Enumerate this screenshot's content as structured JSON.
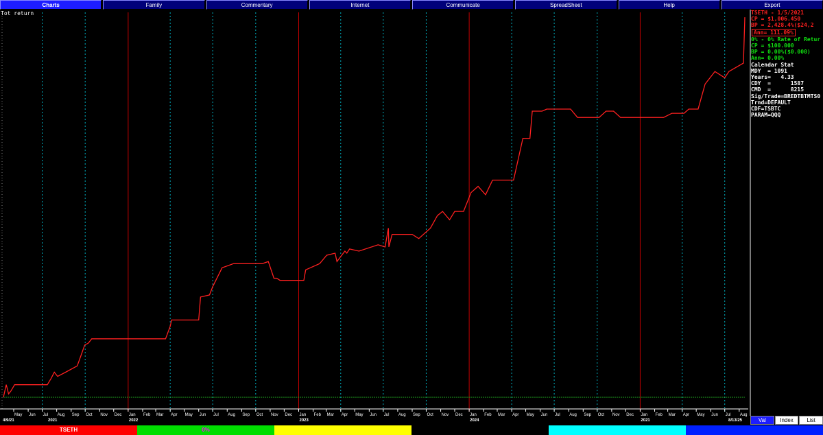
{
  "menu": {
    "items": [
      "Charts",
      "Family",
      "Commentary",
      "Internet",
      "Communicate",
      "SpreadSheet",
      "Help",
      "Export"
    ],
    "active_index": 0
  },
  "chart": {
    "title": "Tot return",
    "date_start": "4/9/21",
    "date_end": "8/13/25",
    "year_labels": [
      "2021",
      "2022",
      "2023",
      "2024"
    ],
    "month_labels": [
      "May",
      "Jun",
      "Jul",
      "Aug",
      "Sep",
      "Oct",
      "Nov",
      "Dec",
      "Jan",
      "Feb",
      "Mar",
      "Apr",
      "May",
      "Jun",
      "Jul",
      "Aug",
      "Sep",
      "Oct",
      "Nov",
      "Dec",
      "Jan",
      "Feb",
      "Mar",
      "Apr",
      "May",
      "Jun",
      "Jul",
      "Aug",
      "Sep",
      "Oct",
      "Nov",
      "Dec",
      "Jan",
      "Feb",
      "Mar",
      "Apr",
      "May",
      "Jun",
      "Jul",
      "Aug",
      "Sep",
      "Oct",
      "Nov",
      "Dec",
      "Jan",
      "Feb",
      "Mar",
      "Apr",
      "May",
      "Jun",
      "Jul",
      "Aug"
    ],
    "colors": {
      "line": "#ff2020",
      "grid": "#00b0c0",
      "year_line": "#c00000",
      "baseline": "#20a020"
    }
  },
  "chart_data": {
    "type": "line",
    "title": "Tot return",
    "xlabel": "",
    "ylabel": "",
    "x_range": [
      "2021-04-09",
      "2025-08-13"
    ],
    "ylim": [
      100,
      1020
    ],
    "series": [
      {
        "name": "TSETH",
        "color": "#ff2020",
        "x": [
          "2021-04-09",
          "2021-04-15",
          "2021-04-20",
          "2021-04-25",
          "2021-05-03",
          "2021-07-12",
          "2021-07-20",
          "2021-07-27",
          "2021-08-03",
          "2021-08-20",
          "2021-09-14",
          "2021-09-22",
          "2021-09-30",
          "2021-10-08",
          "2021-10-15",
          "2021-12-05",
          "2022-01-08",
          "2022-03-22",
          "2022-04-01",
          "2022-04-04",
          "2022-06-01",
          "2022-06-05",
          "2022-06-24",
          "2022-07-01",
          "2022-07-21",
          "2022-08-15",
          "2022-09-05",
          "2022-10-15",
          "2022-10-28",
          "2022-11-09",
          "2022-11-15",
          "2022-11-22",
          "2023-01-12",
          "2023-01-16",
          "2023-02-15",
          "2023-03-02",
          "2023-03-20",
          "2023-03-24",
          "2023-04-10",
          "2023-04-14",
          "2023-04-20",
          "2023-05-10",
          "2023-06-20",
          "2023-07-05",
          "2023-07-12",
          "2023-07-13",
          "2023-07-20",
          "2023-09-01",
          "2023-09-15",
          "2023-10-10",
          "2023-10-25",
          "2023-11-05",
          "2023-11-20",
          "2023-12-01",
          "2023-12-20",
          "2024-01-05",
          "2024-01-20",
          "2024-02-05",
          "2024-02-20",
          "2024-04-05",
          "2024-04-25",
          "2024-05-10",
          "2024-05-15",
          "2024-06-05",
          "2024-06-15",
          "2024-08-05",
          "2024-08-20",
          "2024-10-05",
          "2024-10-20",
          "2024-11-05",
          "2024-11-20",
          "2025-02-20",
          "2025-03-10",
          "2025-04-05",
          "2025-04-15",
          "2025-05-05",
          "2025-05-20",
          "2025-06-10",
          "2025-07-01",
          "2025-07-10",
          "2025-08-10",
          "2025-08-13"
        ],
        "y": [
          100,
          130,
          108,
          115,
          130,
          130,
          145,
          160,
          150,
          160,
          175,
          200,
          225,
          230,
          240,
          240,
          240,
          240,
          270,
          285,
          285,
          340,
          345,
          365,
          410,
          420,
          420,
          420,
          425,
          385,
          385,
          380,
          380,
          405,
          420,
          440,
          445,
          425,
          450,
          445,
          455,
          450,
          465,
          460,
          505,
          460,
          490,
          490,
          480,
          505,
          535,
          545,
          525,
          545,
          545,
          590,
          605,
          585,
          620,
          620,
          720,
          720,
          785,
          785,
          790,
          790,
          770,
          770,
          785,
          785,
          770,
          770,
          780,
          780,
          790,
          790,
          850,
          880,
          865,
          880,
          900,
          1010
        ]
      }
    ]
  },
  "panel": {
    "tseth_header": "TSETH - 1/5/2021",
    "tseth_cp": "CP = $1,006.450",
    "tseth_bp": "BP = 2,428.4%($24,2",
    "tseth_ann": "Ann= 111.09%",
    "zero_header": "0% - 0% Rate of Retur",
    "zero_cp": "CP = $100.000",
    "zero_bp": "BP = 0.00%($0.000)",
    "zero_ann": "Ann= 0.00%",
    "cal_header": "Calendar Stat",
    "mdy": "MDY  = 1091",
    "years": "Years=   4.33",
    "cdy": "CDY  =      1587",
    "cmd": "CMD  =      8215",
    "sig": "Sig/Trade=BREDTBTMTS0",
    "trnd": "Trnd=DEFAULT",
    "cdf": "CDF=TSBTC",
    "param": "PARAM=QQQ"
  },
  "panel_tabs": [
    "Val",
    "Index",
    "List"
  ],
  "strip": {
    "segments": [
      {
        "label": "TSETH",
        "bg": "#ff0000",
        "fg": "#ffffff"
      },
      {
        "label": "0%",
        "bg": "#00dd00",
        "fg": "#ff00ff"
      },
      {
        "label": "",
        "bg": "#ffff00",
        "fg": "#000000"
      },
      {
        "label": "",
        "bg": "#000000",
        "fg": "#ffffff"
      },
      {
        "label": "",
        "bg": "#00ffff",
        "fg": "#000000"
      },
      {
        "label": "",
        "bg": "#0020ff",
        "fg": "#ffffff"
      }
    ]
  }
}
